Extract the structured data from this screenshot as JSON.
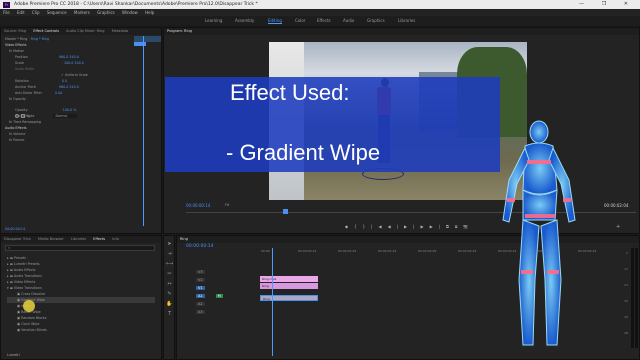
{
  "window": {
    "title": "Adobe Premiere Pro CC 2018 - C:\\Users\\Ravi Shankar\\Documents\\Adobe\\Premiere Pro\\12.0\\Disappear Trick *",
    "logo_text": "Pr",
    "controls": "— ❐ ✕"
  },
  "menu": [
    "File",
    "Edit",
    "Clip",
    "Sequence",
    "Markers",
    "Graphics",
    "Window",
    "Help"
  ],
  "workspaces": [
    "Learning",
    "Assembly",
    "Editing",
    "Color",
    "Effects",
    "Audio",
    "Graphics",
    "Libraries"
  ],
  "active_workspace": "Editing",
  "left_panel": {
    "tabs": [
      "Source: Ring",
      "Effect Controls",
      "Audio Clip Mixer: Ring",
      "Metadata"
    ],
    "header": "Master * Ring",
    "header_right": "Ring * Ring",
    "section_video": "Video Effects",
    "rows": [
      {
        "label": "fx  Motion",
        "value": ""
      },
      {
        "label": "Position",
        "value": "960.0   540.0"
      },
      {
        "label": "Scale",
        "value": "100.0   100.0"
      },
      {
        "label": "Scale Width",
        "value": ""
      },
      {
        "label": "",
        "value": "✓ Uniform Scale"
      },
      {
        "label": "Rotation",
        "value": "0.0"
      },
      {
        "label": "Anchor Point",
        "value": "960.0   540.0"
      },
      {
        "label": "Anti-flicker Filter",
        "value": "0.00"
      },
      {
        "label": "fx  Opacity",
        "value": ""
      },
      {
        "label": "Opacity",
        "value": "100.0 %"
      },
      {
        "label": "Blend Mode",
        "value": "Normal"
      },
      {
        "label": "fx  Time Remapping",
        "value": ""
      }
    ],
    "section_audio": "Audio Effects",
    "audio_rows": [
      "fx  Volume",
      "fx  Panner"
    ],
    "timecode": "00:00:00:14"
  },
  "program": {
    "tab": "Program: Ring",
    "timecode_left": "00:00:00:14",
    "fit": "Fit",
    "quality": "Full",
    "timecode_right": "00:00:02:04",
    "controls": [
      "◆",
      "{",
      "}",
      "|◀",
      "◀|",
      "▶",
      "|▶",
      "▶|",
      "⧉",
      "⧈",
      "📷",
      "+"
    ]
  },
  "overlay": {
    "line1": "Effect Used:",
    "line2": "- Gradient Wipe"
  },
  "project": {
    "tabs": [
      "Disappear Trick",
      "Media Browser",
      "Libraries",
      "Effects",
      "Info"
    ],
    "search_placeholder": "",
    "folders": [
      "Presets",
      "Lumetri Presets",
      "Audio Effects",
      "Audio Transitions",
      "Video Effects",
      "Video Transitions"
    ],
    "subitems": [
      "Cross Dissolve",
      "Gradient Wipe",
      "Inset",
      "Radial Wipe",
      "Random Blocks",
      "Clock Wipe",
      "Venetian Blinds"
    ],
    "footer": "Lumetri"
  },
  "timeline": {
    "tab": "Ring",
    "timecode": "00:00:00:14",
    "ruler": [
      "00:00",
      "00:00:00:14",
      "00:00:01:04",
      "00:00:01:19",
      "00:00:02:09",
      "00:00:02:24",
      "00:00:03:14",
      "00:00:04:04",
      "00:00:04:19"
    ],
    "tracks": [
      "V3",
      "V2",
      "V1",
      "A1",
      "A2",
      "A3"
    ],
    "clips": [
      {
        "label": "Ring.mp4",
        "track": "V3"
      },
      {
        "label": "Ring",
        "track": "V2"
      },
      {
        "label": "Ring",
        "track": "V1"
      }
    ],
    "db_scale": [
      "0",
      "-12",
      "-24",
      "-36",
      "-48",
      "dB"
    ]
  }
}
